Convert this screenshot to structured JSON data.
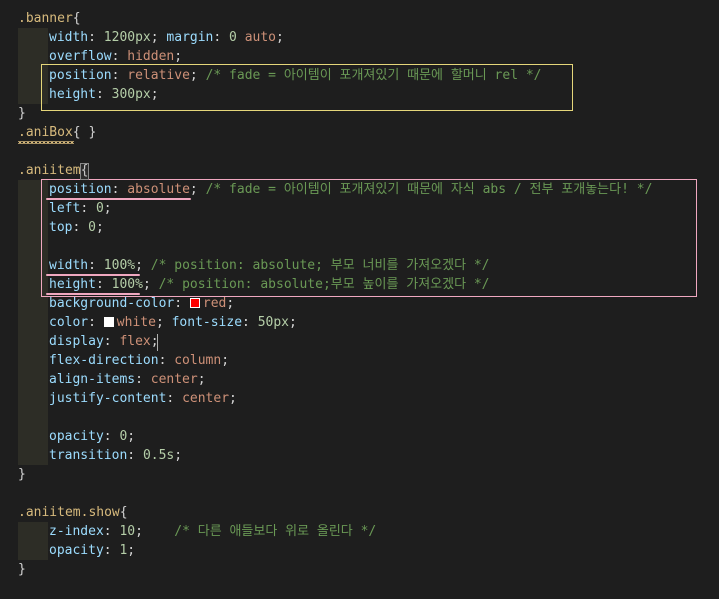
{
  "colors": {
    "background": "#1e1e1e",
    "selector": "#d7ba7d",
    "property": "#9cdcfe",
    "value_keyword": "#ce9178",
    "number": "#b5cea8",
    "comment": "#6a9955",
    "punctuation": "#d4d4d4",
    "yellow_box": "#e5d67a",
    "pink_box": "#f0a8c0",
    "swatch_red": "#ff0000",
    "swatch_white": "#ffffff"
  },
  "lines": [
    {
      "tokens": [
        {
          "t": ".banner",
          "c": "selector"
        },
        {
          "t": "{",
          "c": "punctuation"
        }
      ]
    },
    {
      "indent": true,
      "tokens": [
        {
          "t": "width",
          "c": "property"
        },
        {
          "t": ": ",
          "c": "punctuation"
        },
        {
          "t": "1200px",
          "c": "number"
        },
        {
          "t": "; ",
          "c": "punctuation"
        },
        {
          "t": "margin",
          "c": "property"
        },
        {
          "t": ": ",
          "c": "punctuation"
        },
        {
          "t": "0",
          "c": "number"
        },
        {
          "t": " ",
          "c": "punctuation"
        },
        {
          "t": "auto",
          "c": "value_keyword"
        },
        {
          "t": ";",
          "c": "punctuation"
        }
      ]
    },
    {
      "indent": true,
      "tokens": [
        {
          "t": "overflow",
          "c": "property"
        },
        {
          "t": ": ",
          "c": "punctuation"
        },
        {
          "t": "hidden",
          "c": "value_keyword"
        },
        {
          "t": ";",
          "c": "punctuation"
        }
      ]
    },
    {
      "indent": true,
      "tokens": [
        {
          "t": "position",
          "c": "property"
        },
        {
          "t": ": ",
          "c": "punctuation"
        },
        {
          "t": "relative",
          "c": "value_keyword"
        },
        {
          "t": "; ",
          "c": "punctuation"
        },
        {
          "t": "/* fade = 아이템이 포개져있기 때문에 할머니 rel */",
          "c": "comment"
        }
      ]
    },
    {
      "indent": true,
      "tokens": [
        {
          "t": "height",
          "c": "property"
        },
        {
          "t": ": ",
          "c": "punctuation"
        },
        {
          "t": "300px",
          "c": "number"
        },
        {
          "t": ";",
          "c": "punctuation"
        }
      ]
    },
    {
      "tokens": [
        {
          "t": "}",
          "c": "punctuation"
        }
      ]
    },
    {
      "tokens": [
        {
          "t": ".aniBox",
          "c": "selector"
        },
        {
          "t": "{ }",
          "c": "punctuation"
        }
      ]
    },
    {
      "tokens": []
    },
    {
      "tokens": [
        {
          "t": ".aniitem",
          "c": "selector"
        },
        {
          "t": "{",
          "c": "punctuation"
        }
      ]
    },
    {
      "indent": true,
      "tokens": [
        {
          "t": "position",
          "c": "property"
        },
        {
          "t": ": ",
          "c": "punctuation"
        },
        {
          "t": "absolute",
          "c": "value_keyword"
        },
        {
          "t": "; ",
          "c": "punctuation"
        },
        {
          "t": "/* fade = 아이템이 포개져있기 때문에 자식 abs / 전부 포개놓는다! */",
          "c": "comment"
        }
      ]
    },
    {
      "indent": true,
      "tokens": [
        {
          "t": "left",
          "c": "property"
        },
        {
          "t": ": ",
          "c": "punctuation"
        },
        {
          "t": "0",
          "c": "number"
        },
        {
          "t": ";",
          "c": "punctuation"
        }
      ]
    },
    {
      "indent": true,
      "tokens": [
        {
          "t": "top",
          "c": "property"
        },
        {
          "t": ": ",
          "c": "punctuation"
        },
        {
          "t": "0",
          "c": "number"
        },
        {
          "t": ";",
          "c": "punctuation"
        }
      ]
    },
    {
      "indent": true,
      "tokens": []
    },
    {
      "indent": true,
      "tokens": [
        {
          "t": "width",
          "c": "property"
        },
        {
          "t": ": ",
          "c": "punctuation"
        },
        {
          "t": "100%",
          "c": "number"
        },
        {
          "t": "; ",
          "c": "punctuation"
        },
        {
          "t": "/* position: absolute; 부모 너비를 가져오겠다 */",
          "c": "comment"
        }
      ]
    },
    {
      "indent": true,
      "tokens": [
        {
          "t": "height",
          "c": "property"
        },
        {
          "t": ": ",
          "c": "punctuation"
        },
        {
          "t": "100%",
          "c": "number"
        },
        {
          "t": "; ",
          "c": "punctuation"
        },
        {
          "t": "/* position: absolute;부모 높이를 가져오겠다 */",
          "c": "comment"
        }
      ]
    },
    {
      "indent": true,
      "tokens": [
        {
          "t": "background-color",
          "c": "property"
        },
        {
          "t": ": ",
          "c": "punctuation"
        },
        {
          "swatch": "swatch_red"
        },
        {
          "t": "red",
          "c": "value_keyword"
        },
        {
          "t": ";",
          "c": "punctuation"
        }
      ]
    },
    {
      "indent": true,
      "tokens": [
        {
          "t": "color",
          "c": "property"
        },
        {
          "t": ": ",
          "c": "punctuation"
        },
        {
          "swatch": "swatch_white"
        },
        {
          "t": "white",
          "c": "value_keyword"
        },
        {
          "t": "; ",
          "c": "punctuation"
        },
        {
          "t": "font-size",
          "c": "property"
        },
        {
          "t": ": ",
          "c": "punctuation"
        },
        {
          "t": "50px",
          "c": "number"
        },
        {
          "t": ";",
          "c": "punctuation"
        }
      ]
    },
    {
      "indent": true,
      "tokens": [
        {
          "t": "display",
          "c": "property"
        },
        {
          "t": ": ",
          "c": "punctuation"
        },
        {
          "t": "flex",
          "c": "value_keyword"
        },
        {
          "t": ";",
          "c": "punctuation"
        }
      ]
    },
    {
      "indent": true,
      "tokens": [
        {
          "t": "flex-direction",
          "c": "property"
        },
        {
          "t": ": ",
          "c": "punctuation"
        },
        {
          "t": "column",
          "c": "value_keyword"
        },
        {
          "t": ";",
          "c": "punctuation"
        }
      ]
    },
    {
      "indent": true,
      "tokens": [
        {
          "t": "align-items",
          "c": "property"
        },
        {
          "t": ": ",
          "c": "punctuation"
        },
        {
          "t": "center",
          "c": "value_keyword"
        },
        {
          "t": ";",
          "c": "punctuation"
        }
      ]
    },
    {
      "indent": true,
      "tokens": [
        {
          "t": "justify-content",
          "c": "property"
        },
        {
          "t": ": ",
          "c": "punctuation"
        },
        {
          "t": "center",
          "c": "value_keyword"
        },
        {
          "t": ";",
          "c": "punctuation"
        }
      ]
    },
    {
      "indent": true,
      "tokens": []
    },
    {
      "indent": true,
      "tokens": [
        {
          "t": "opacity",
          "c": "property"
        },
        {
          "t": ": ",
          "c": "punctuation"
        },
        {
          "t": "0",
          "c": "number"
        },
        {
          "t": ";",
          "c": "punctuation"
        }
      ]
    },
    {
      "indent": true,
      "tokens": [
        {
          "t": "transition",
          "c": "property"
        },
        {
          "t": ": ",
          "c": "punctuation"
        },
        {
          "t": "0.5s",
          "c": "number"
        },
        {
          "t": ";",
          "c": "punctuation"
        }
      ]
    },
    {
      "tokens": [
        {
          "t": "}",
          "c": "punctuation"
        }
      ]
    },
    {
      "tokens": []
    },
    {
      "tokens": [
        {
          "t": ".aniitem.show",
          "c": "selector"
        },
        {
          "t": "{",
          "c": "punctuation"
        }
      ]
    },
    {
      "indent": true,
      "tokens": [
        {
          "t": "z-index",
          "c": "property"
        },
        {
          "t": ": ",
          "c": "punctuation"
        },
        {
          "t": "10",
          "c": "number"
        },
        {
          "t": ";    ",
          "c": "punctuation"
        },
        {
          "t": "/* 다른 애들보다 위로 올린다 */",
          "c": "comment"
        }
      ]
    },
    {
      "indent": true,
      "tokens": [
        {
          "t": "opacity",
          "c": "property"
        },
        {
          "t": ": ",
          "c": "punctuation"
        },
        {
          "t": "1",
          "c": "number"
        },
        {
          "t": ";",
          "c": "punctuation"
        }
      ]
    },
    {
      "tokens": [
        {
          "t": "}",
          "c": "punctuation"
        }
      ]
    }
  ]
}
